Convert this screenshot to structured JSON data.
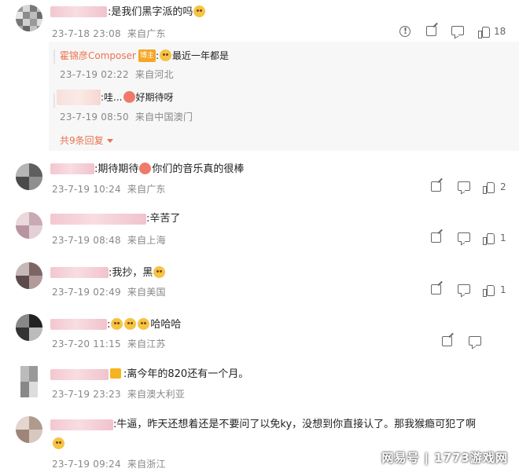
{
  "comments": [
    {
      "text": ":是我们黑字派的吗",
      "time": "23-7-18 23:08",
      "location": "来自广东",
      "likes": "18",
      "replies": [
        {
          "name": "霍锦彦Composer",
          "badge": "博主",
          "text": "最近一年都是",
          "time": "23-7-19 02:22",
          "location": "来自河北"
        },
        {
          "text": ":哇...",
          "text2": "好期待呀",
          "time": "23-7-19 08:50",
          "location": "来自中国澳门"
        }
      ],
      "more_replies": "共9条回复"
    },
    {
      "text": ":期待期待",
      "text2": "你们的音乐真的很棒",
      "time": "23-7-19 10:24",
      "location": "来自广东",
      "likes": "2"
    },
    {
      "text": ":辛苦了",
      "time": "23-7-19 08:48",
      "location": "来自上海",
      "likes": "1"
    },
    {
      "text": ":我抄，黑",
      "time": "23-7-19 02:49",
      "location": "来自美国",
      "likes": "1"
    },
    {
      "text": "哈哈哈",
      "time": "23-7-20 11:15",
      "location": "来自江苏",
      "likes": ""
    },
    {
      "text": ":离今年的820还有一个月。",
      "time": "23-7-19 23:23",
      "location": "来自澳大利亚",
      "likes": ""
    },
    {
      "text": ":牛逼，昨天还想着还是不要问了以免ky，没想到你直接认了。那我猴瘾可犯了啊",
      "time": "23-7-19 09:24",
      "location": "来自浙江",
      "likes": ""
    }
  ],
  "watermark": "网易号 | 1773游戏网"
}
